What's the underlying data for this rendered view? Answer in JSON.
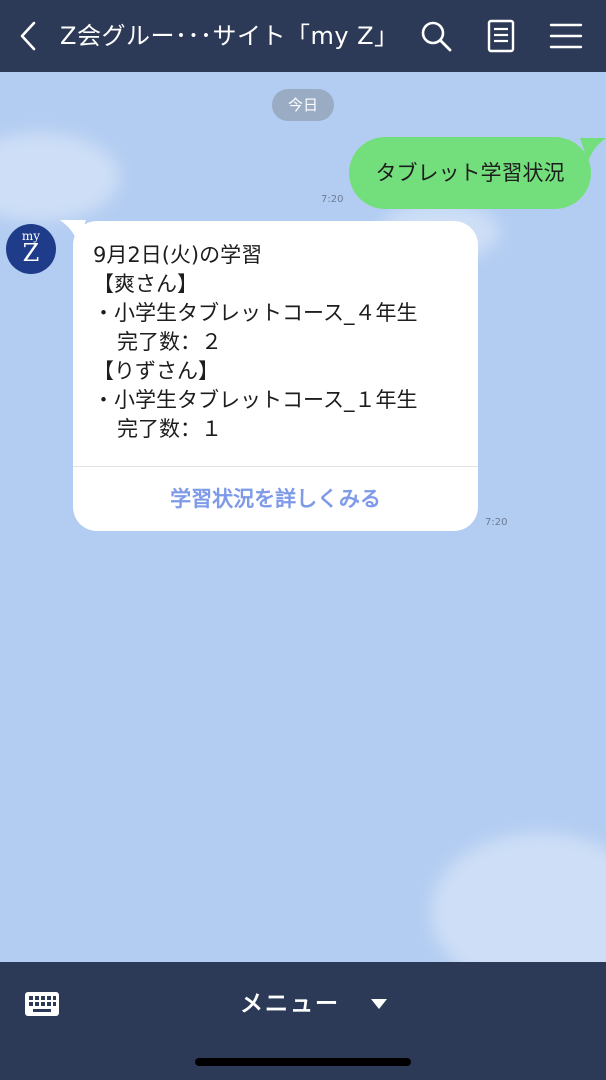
{
  "header": {
    "title": "Z会グルー･･･サイト「my Z」",
    "icons": [
      "back-icon",
      "search-icon",
      "notes-icon",
      "menu-icon"
    ]
  },
  "chat": {
    "date_label": "今日",
    "sent_message": {
      "text": "タブレット学習状況",
      "time": "7:20"
    },
    "received_message": {
      "avatar_line1": "my",
      "avatar_line2": "Z",
      "lines": [
        "9月2日(火)の学習",
        "【爽さん】",
        "・小学生タブレットコース_４年生",
        "完了数：２",
        "【りずさん】",
        "・小学生タブレットコース_１年生",
        "完了数：１"
      ],
      "link_label": "学習状況を詳しくみる",
      "time": "7:20"
    }
  },
  "bottom_bar": {
    "menu_label": "メニュー",
    "icons": [
      "keyboard-icon",
      "caret-down-icon"
    ]
  },
  "colors": {
    "header_bg": "#2d3a57",
    "chat_bg": "#b3cdf2",
    "sent_bubble": "#73df7c",
    "link": "#7e9ae8",
    "avatar_bg": "#1f3c8a"
  }
}
